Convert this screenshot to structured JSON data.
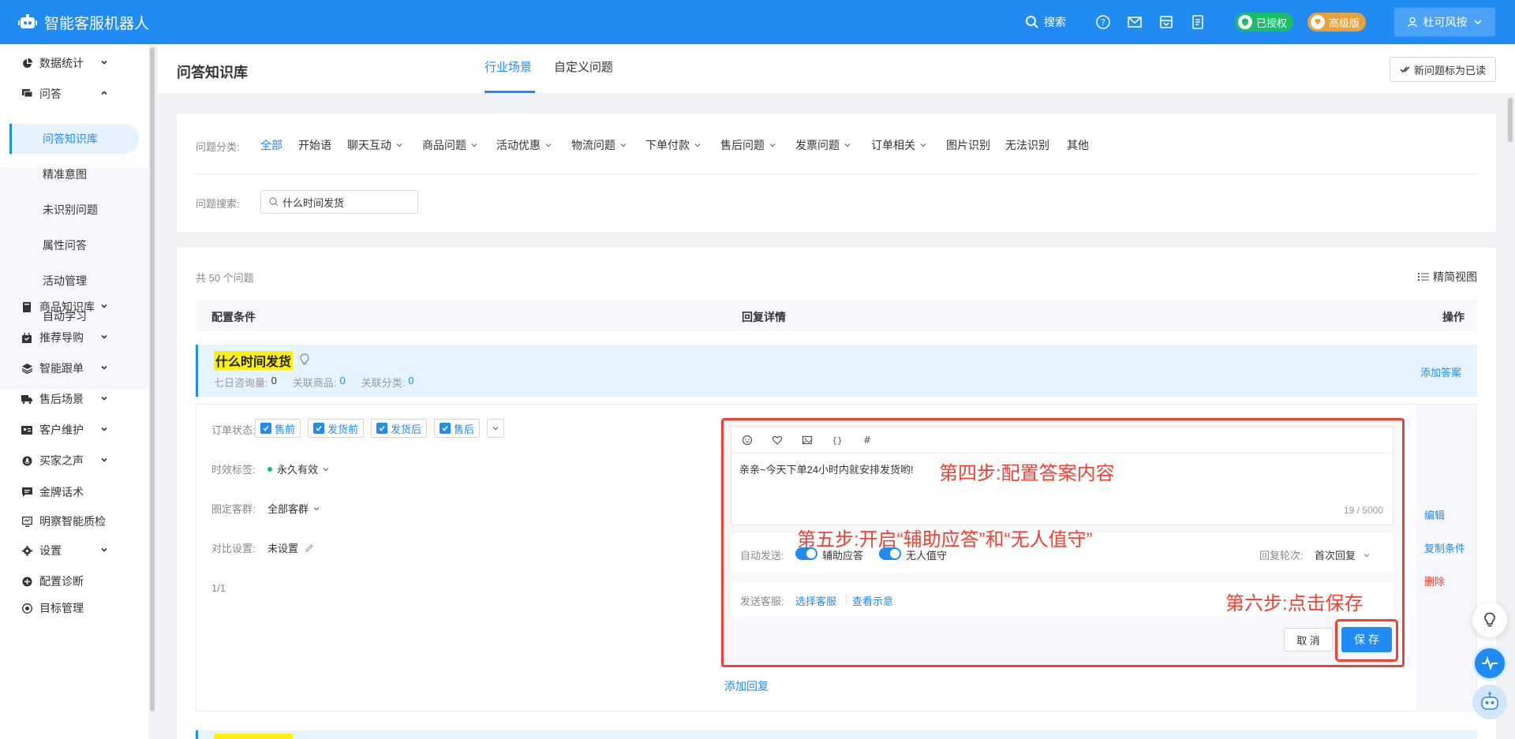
{
  "app": {
    "title": "智能客服机器人"
  },
  "topbar": {
    "search_label": "搜索",
    "badge_authorized": "已授权",
    "badge_pro": "高级版",
    "user_name": "杜可风按"
  },
  "sidebar": {
    "items": [
      {
        "label": "数据统计",
        "icon": "pie-chart-icon"
      },
      {
        "label": "问答",
        "icon": "chat-icon",
        "expanded": true
      },
      {
        "label": "商品知识库",
        "icon": "book-icon"
      },
      {
        "label": "推荐导购",
        "icon": "bag-icon"
      },
      {
        "label": "智能跟单",
        "icon": "layers-icon"
      },
      {
        "label": "售后场景",
        "icon": "truck-icon"
      },
      {
        "label": "客户维护",
        "icon": "id-card-icon"
      },
      {
        "label": "买家之声",
        "icon": "voice-icon"
      },
      {
        "label": "金牌话术",
        "icon": "message-icon"
      },
      {
        "label": "明察智能质检",
        "icon": "monitor-icon"
      },
      {
        "label": "设置",
        "icon": "gear-icon"
      },
      {
        "label": "配置诊断",
        "icon": "diagnose-icon"
      },
      {
        "label": "目标管理",
        "icon": "target-icon"
      }
    ],
    "subitems": [
      {
        "label": "问答知识库",
        "active": true
      },
      {
        "label": "精准意图"
      },
      {
        "label": "未识别问题"
      },
      {
        "label": "属性问答"
      },
      {
        "label": "活动管理"
      },
      {
        "label": "自动学习"
      }
    ]
  },
  "header": {
    "page_title": "问答知识库",
    "tabs": [
      {
        "label": "行业场景",
        "active": true
      },
      {
        "label": "自定义问题"
      }
    ],
    "mark_read": "新问题标为已读"
  },
  "filter": {
    "category_label": "问题分类:",
    "categories": [
      {
        "label": "全部",
        "active": true,
        "dropdown": false
      },
      {
        "label": "开始语",
        "dropdown": false
      },
      {
        "label": "聊天互动",
        "dropdown": true
      },
      {
        "label": "商品问题",
        "dropdown": true
      },
      {
        "label": "活动优惠",
        "dropdown": true
      },
      {
        "label": "物流问题",
        "dropdown": true
      },
      {
        "label": "下单付款",
        "dropdown": true
      },
      {
        "label": "售后问题",
        "dropdown": true
      },
      {
        "label": "发票问题",
        "dropdown": true
      },
      {
        "label": "订单相关",
        "dropdown": true
      },
      {
        "label": "图片识别",
        "dropdown": false
      },
      {
        "label": "无法识别",
        "dropdown": false
      },
      {
        "label": "其他",
        "dropdown": false
      }
    ],
    "search_label": "问题搜索:",
    "search_value": "什么时间发货"
  },
  "list": {
    "count_text": "共 50 个问题",
    "view_toggle": "精简视图",
    "columns": {
      "config": "配置条件",
      "reply": "回复详情",
      "action": "操作"
    },
    "question": {
      "title": "什么时间发货",
      "meta": [
        {
          "label": "七日咨询量:",
          "value": "0"
        },
        {
          "label": "关联商品:",
          "value": "0"
        },
        {
          "label": "关联分类:",
          "value": "0"
        }
      ],
      "add_answer": "添加答案"
    },
    "conditions": {
      "order_status_label": "订单状态:",
      "order_status_options": [
        "售前",
        "发货前",
        "发货后",
        "售后"
      ],
      "time_label_label": "时效标签:",
      "time_label_value": "永久有效",
      "crowd_label": "圈定客群:",
      "crowd_value": "全部客群",
      "compare_label": "对比设置:",
      "compare_value": "未设置",
      "pager": "1/1"
    },
    "editor": {
      "content": "亲亲~今天下单24小时内就安排发货哟!",
      "count": "19 / 5000",
      "auto_send_label": "自动发送:",
      "toggle_assist": "辅助应答",
      "toggle_unattended": "无人值守",
      "round_label": "回复轮次:",
      "round_value": "首次回复",
      "send_label": "发送客服:",
      "select_agent": "选择客服",
      "view_example": "查看示意",
      "cancel": "取 消",
      "save": "保 存"
    },
    "side_actions": {
      "edit": "编辑",
      "copy": "复制条件",
      "delete": "删除"
    },
    "add_reply": "添加回复"
  },
  "annotations": {
    "step4": "第四步:配置答案内容",
    "step5": "第五步:开启“辅助应答”和“无人值守”",
    "step6": "第六步:点击保存"
  },
  "colors": {
    "primary": "#1f8bf3",
    "annotation": "#f04134",
    "highlight": "#ffef13"
  }
}
